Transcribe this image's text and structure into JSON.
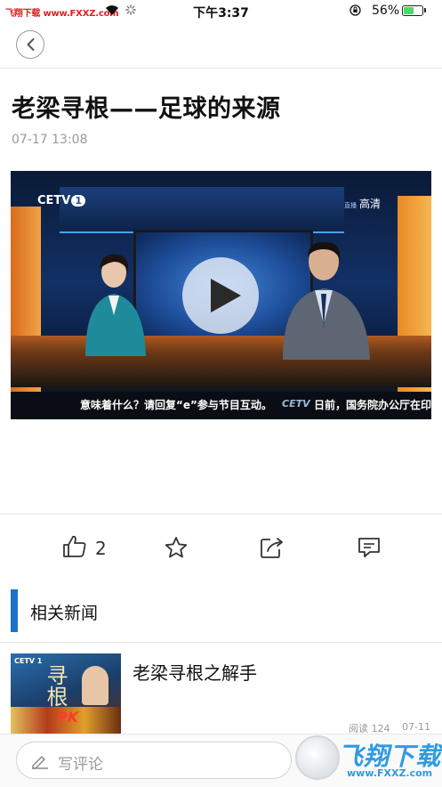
{
  "status_bar": {
    "carrier": "飞翔下载 www.FXXZ.com",
    "time": "下午3:37",
    "battery_percent": "56%",
    "battery_level": 0.56,
    "icons": [
      "wifi-icon",
      "spinner-icon",
      "orientation-lock-icon",
      "battery-icon"
    ]
  },
  "nav": {
    "back_icon": "chevron-left-icon"
  },
  "article": {
    "title": "老梁寻根——足球的来源",
    "time": "07-17 13:08"
  },
  "video": {
    "channel_logo": "CETV",
    "channel_number": "1",
    "hd_badge_prefix": "直播",
    "hd_badge": "高清",
    "ticker_text": "意味着什么？请回复“e”参与节目互动。",
    "ticker_logo": "CETV",
    "ticker_text_2": "日前，国务院办公厅在印发",
    "play_icon": "play-icon"
  },
  "actions": {
    "like_icon": "thumbs-up-icon",
    "like_count": "2",
    "favorite_icon": "star-icon",
    "share_icon": "share-icon",
    "comment_icon": "comment-icon"
  },
  "related": {
    "section_title": "相关新闻",
    "items": [
      {
        "title": "老梁寻根之解手",
        "read_label": "阅读 124",
        "date": "07-11",
        "thumb_logo": "CETV 1",
        "thumb_calligraphy": "寻根",
        "thumb_badge": "PK"
      }
    ]
  },
  "comment_bar": {
    "placeholder": "写评论",
    "icon": "pencil-icon"
  },
  "watermark": {
    "text": "飞翔下载",
    "url": "www.FXXZ.com"
  },
  "colors": {
    "accent": "#1a73c9",
    "carrier_red": "#d92020",
    "battery_green": "#4cd964",
    "watermark_blue": "#2f9be0"
  }
}
